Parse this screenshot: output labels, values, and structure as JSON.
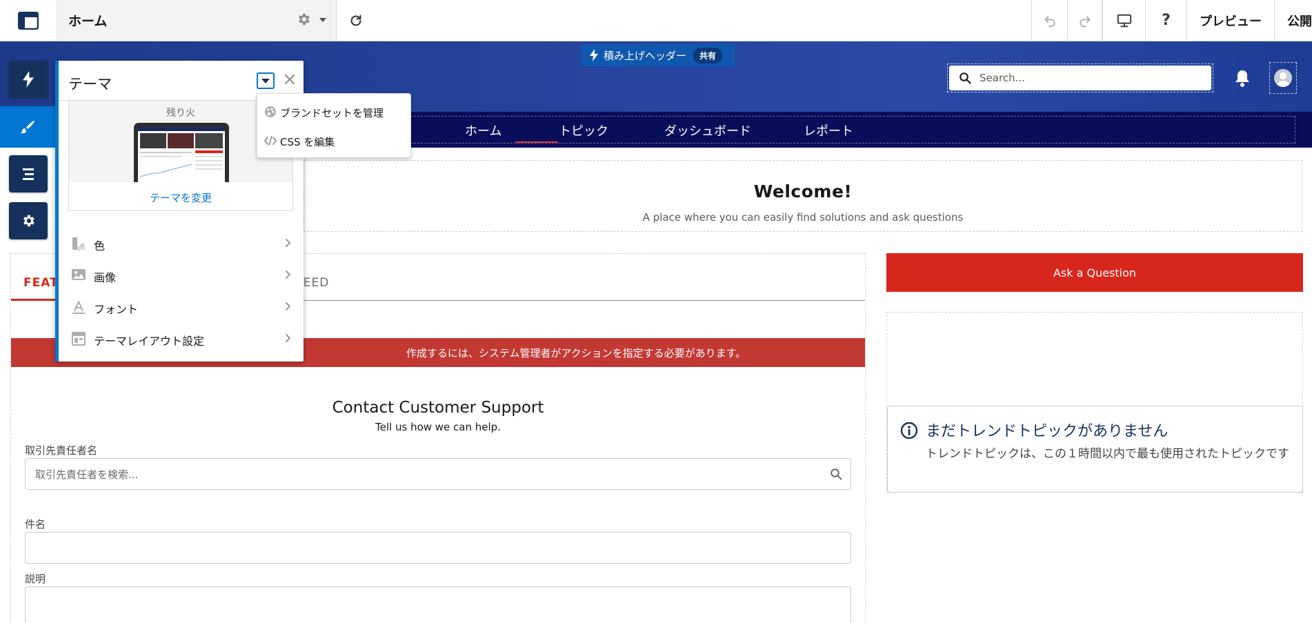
{
  "topbar": {
    "page_name": "ホーム",
    "preview_label": "プレビュー",
    "publish_label": "公開"
  },
  "header": {
    "stacked_header_label": "積み上げヘッダー",
    "shared_badge": "共有",
    "search_placeholder": "Search..."
  },
  "nav": {
    "items": [
      "ホーム",
      "トピック",
      "ダッシュボード",
      "レポート"
    ],
    "active_index": 0
  },
  "welcome": {
    "title": "Welcome!",
    "subtitle": "A place where you can easily find solutions and ask questions"
  },
  "feed": {
    "tab_featured": "FEAT",
    "tab_feed": "FEED",
    "error_message": "作成するには、システム管理者がアクションを指定する必要があります。"
  },
  "contact": {
    "title": "Contact Customer Support",
    "subtitle": "Tell us how we can help.",
    "contact_label": "取引先責任者名",
    "contact_placeholder": "取引先責任者を検索...",
    "subject_label": "件名",
    "description_label": "説明"
  },
  "right": {
    "ask_button": "Ask a Question",
    "trend_title": "まだトレンドトピックがありません",
    "trend_body": "トレンドトピックは、この１時間以内で最も使用されたトピックです"
  },
  "theme_panel": {
    "title": "テーマ",
    "theme_name": "残り火",
    "change_theme": "テーマを変更",
    "items": [
      {
        "label": "色",
        "icon": "color-palette-icon"
      },
      {
        "label": "画像",
        "icon": "image-icon"
      },
      {
        "label": "フォント",
        "icon": "font-icon"
      },
      {
        "label": "テーマレイアウト設定",
        "icon": "layout-icon"
      }
    ]
  },
  "dropdown": {
    "items": [
      {
        "label": "ブランドセットを管理",
        "icon": "brand-palette-icon"
      },
      {
        "label": "CSS を編集",
        "icon": "code-icon"
      }
    ]
  },
  "colors": {
    "accent": "#0176d3",
    "rail_dark": "#16325c",
    "nav_bg": "#0a0e5a",
    "brand_red": "#d7261c",
    "error_red": "#c23934"
  }
}
